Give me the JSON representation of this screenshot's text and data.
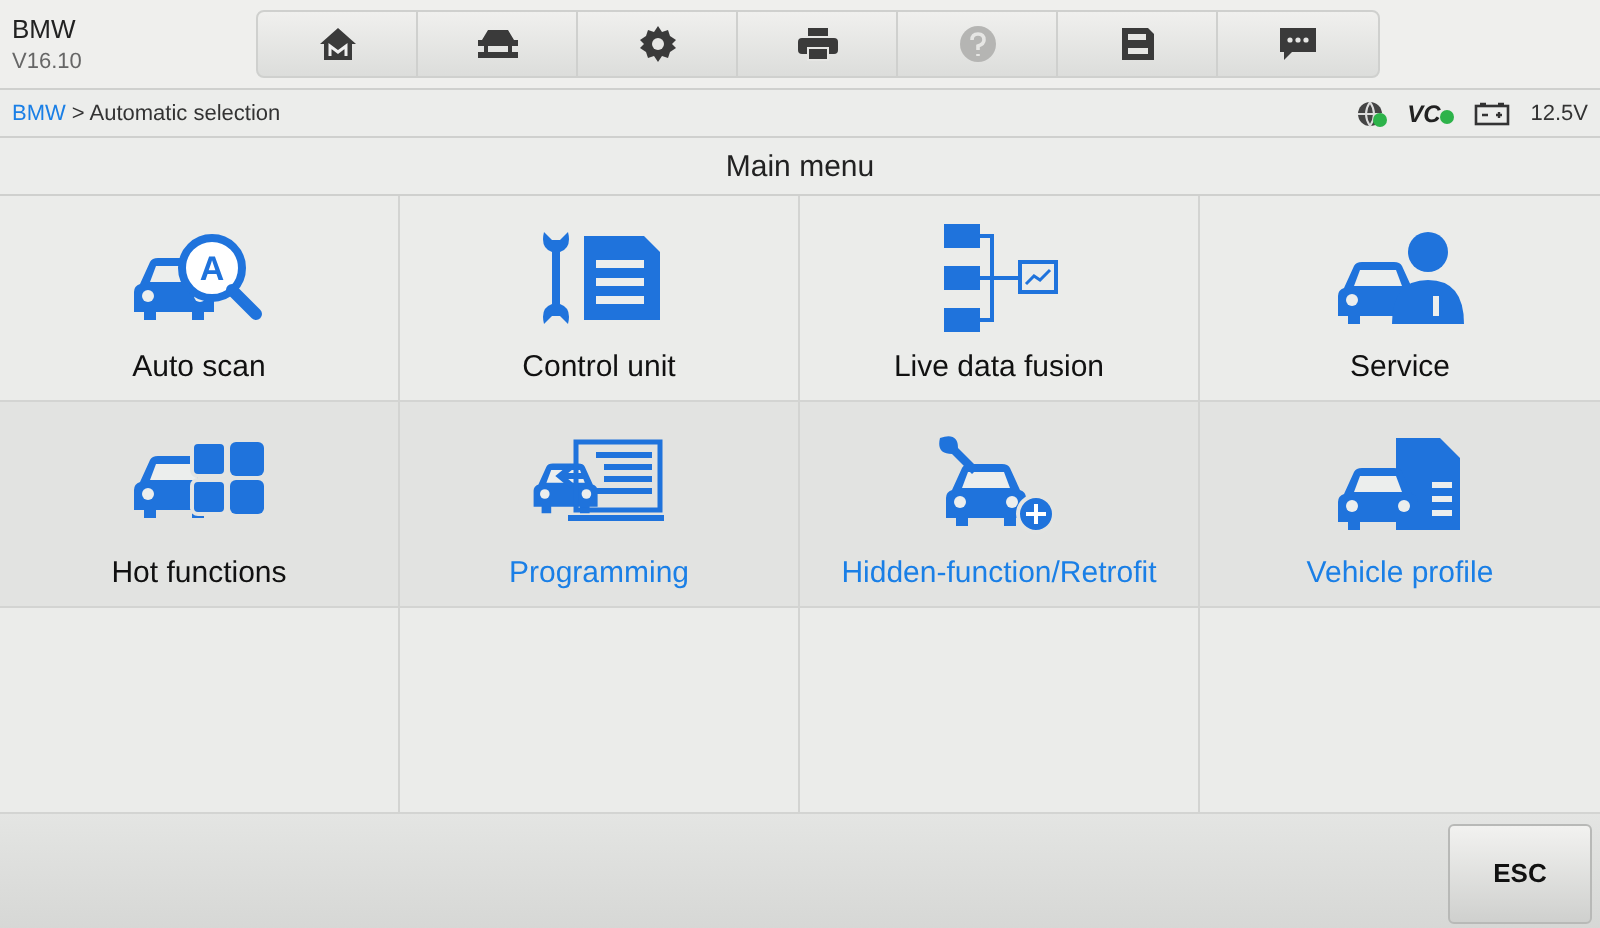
{
  "header": {
    "title": "BMW",
    "version": "V16.10"
  },
  "toolbar": [
    {
      "disabled": false
    },
    {
      "disabled": false
    },
    {
      "disabled": false
    },
    {
      "disabled": false
    },
    {
      "disabled": true
    },
    {
      "disabled": false
    },
    {
      "disabled": false
    }
  ],
  "breadcrumb": {
    "link": "BMW",
    "current": "> Automatic selection"
  },
  "status": {
    "vci": "VC",
    "voltage": "12.5V"
  },
  "menu": {
    "title": "Main menu",
    "items": [
      {
        "label": "Auto scan",
        "color": "#111111",
        "icon_text": "A"
      },
      {
        "label": "Control unit",
        "color": "#111111"
      },
      {
        "label": "Live data fusion",
        "color": "#111111"
      },
      {
        "label": "Service",
        "color": "#111111"
      },
      {
        "label": "Hot functions",
        "color": "#111111"
      },
      {
        "label": "Programming",
        "color": "#1a7fe6"
      },
      {
        "label": "Hidden-function/Retrofit",
        "color": "#1a7fe6"
      },
      {
        "label": "Vehicle profile",
        "color": "#1a7fe6"
      }
    ]
  },
  "footer": {
    "button": "ESC"
  }
}
